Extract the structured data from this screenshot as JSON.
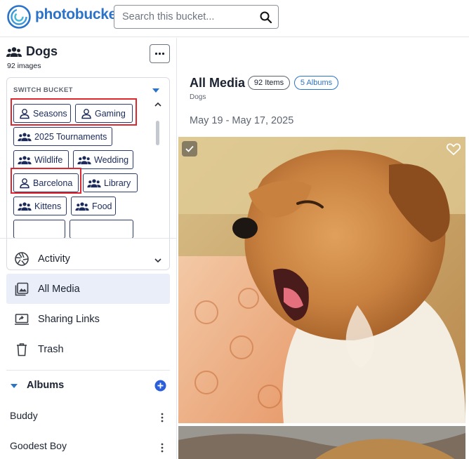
{
  "app": {
    "brand": "photobucket",
    "search_placeholder": "Search this bucket..."
  },
  "bucket": {
    "name": "Dogs",
    "count_label": "92 images",
    "switch_label": "SWITCH BUCKET",
    "chips": [
      {
        "label": "Seasons",
        "icon": "person-icon",
        "highlighted": true
      },
      {
        "label": "Gaming",
        "icon": "person-icon",
        "highlighted": true
      },
      {
        "label": "2025 Tournaments",
        "icon": "group-icon",
        "highlighted": false
      },
      {
        "label": "Wildlife",
        "icon": "group-icon",
        "highlighted": false
      },
      {
        "label": "Wedding",
        "icon": "group-icon",
        "highlighted": false
      },
      {
        "label": "Barcelona",
        "icon": "person-icon",
        "highlighted": true
      },
      {
        "label": "Library",
        "icon": "group-icon",
        "highlighted": false
      },
      {
        "label": "Kittens",
        "icon": "group-icon",
        "highlighted": false
      },
      {
        "label": "Food",
        "icon": "group-icon",
        "highlighted": false
      }
    ]
  },
  "nav": [
    {
      "label": "Activity",
      "icon": "aperture-icon",
      "active": false
    },
    {
      "label": "All Media",
      "icon": "gallery-icon",
      "active": true
    },
    {
      "label": "Sharing Links",
      "icon": "share-screen-icon",
      "active": false
    },
    {
      "label": "Trash",
      "icon": "trash-icon",
      "active": false
    }
  ],
  "albums": {
    "title": "Albums",
    "items": [
      "Buddy",
      "Goodest Boy"
    ]
  },
  "main": {
    "title": "All Media",
    "items_pill": "92 Items",
    "albums_pill": "5 Albums",
    "subtitle": "Dogs",
    "date_range": "May 19 - May 17, 2025"
  },
  "colors": {
    "brand_blue": "#2b73c9",
    "chip_border": "#2d3a6e",
    "highlight_red": "#e0262e",
    "active_nav_bg": "#e9eef8"
  }
}
